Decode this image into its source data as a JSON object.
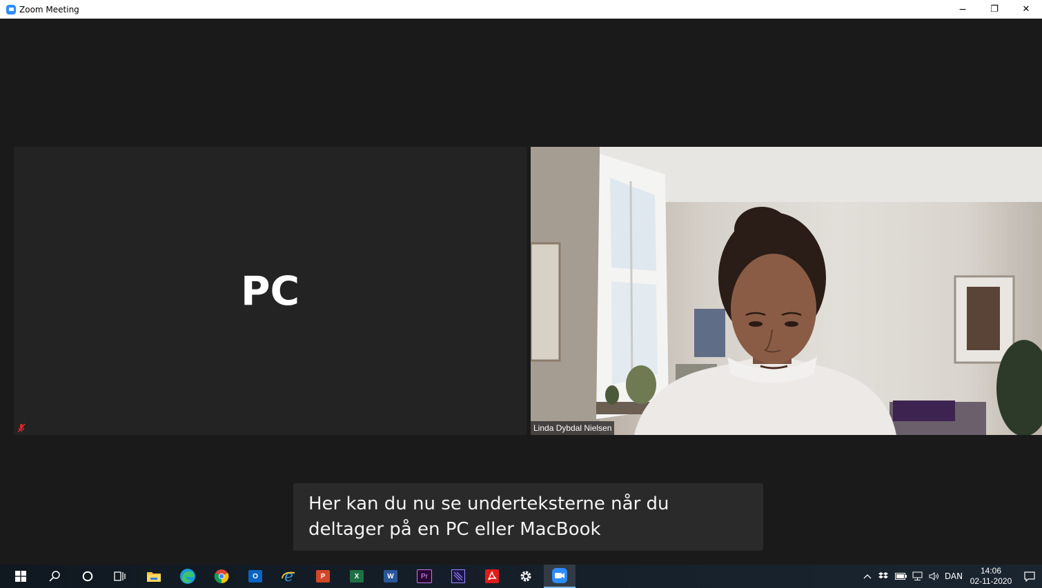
{
  "window": {
    "title": "Zoom Meeting",
    "minimize_glyph": "−",
    "restore_glyph": "❐",
    "close_glyph": "✕"
  },
  "meeting": {
    "left_tile": {
      "display_name": "PC",
      "muted": true,
      "icon": "mic-muted-icon"
    },
    "right_tile": {
      "participant_name": "Linda Dybdal Nielsen"
    }
  },
  "caption": {
    "text": "Her kan du nu se underteksterne når du deltager på en PC eller MacBook"
  },
  "taskbar": {
    "apps": [
      {
        "name": "start-button",
        "icon": "windows-logo-icon"
      },
      {
        "name": "search-button",
        "icon": "search-icon"
      },
      {
        "name": "cortana-button",
        "icon": "circle-icon"
      },
      {
        "name": "task-view-button",
        "icon": "task-view-icon"
      },
      {
        "name": "file-explorer",
        "icon": "folder-icon"
      },
      {
        "name": "edge",
        "icon": "edge-icon"
      },
      {
        "name": "chrome",
        "icon": "chrome-icon"
      },
      {
        "name": "outlook",
        "icon": "outlook-icon",
        "letter": "O"
      },
      {
        "name": "internet-explorer",
        "icon": "ie-icon"
      },
      {
        "name": "powerpoint",
        "icon": "powerpoint-icon",
        "letter": "P"
      },
      {
        "name": "excel",
        "icon": "excel-icon",
        "letter": "X"
      },
      {
        "name": "word",
        "icon": "word-icon",
        "letter": "W"
      },
      {
        "name": "premiere-pro",
        "icon": "premiere-icon",
        "letter": "Pr"
      },
      {
        "name": "media-encoder",
        "icon": "media-encoder-icon"
      },
      {
        "name": "acrobat",
        "icon": "acrobat-icon"
      },
      {
        "name": "settings",
        "icon": "gear-icon"
      },
      {
        "name": "zoom",
        "icon": "zoom-icon",
        "active": true
      }
    ],
    "tray": {
      "language": "DAN",
      "time": "14:06",
      "date": "02-11-2020"
    }
  },
  "colors": {
    "zoom_blue": "#2d8cff",
    "meeting_bg": "#1a1a1a",
    "tile_bg": "#232323",
    "caption_bg": "#2a2a2a",
    "mute_red": "#e02828"
  }
}
